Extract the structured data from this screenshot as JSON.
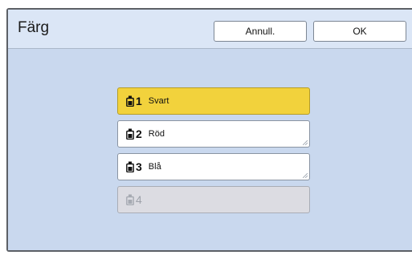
{
  "dialog": {
    "title": "Färg",
    "cancel_label": "Annull.",
    "ok_label": "OK"
  },
  "options": [
    {
      "number": "1",
      "name": "Svart",
      "state": "selected",
      "icon": "ink-bottle-icon"
    },
    {
      "number": "2",
      "name": "Röd",
      "state": "normal",
      "icon": "ink-bottle-icon"
    },
    {
      "number": "3",
      "name": "Blå",
      "state": "normal",
      "icon": "ink-bottle-icon"
    },
    {
      "number": "4",
      "name": "",
      "state": "disabled",
      "icon": "ink-bottle-icon"
    }
  ],
  "colors": {
    "panel": "#c9d8ee",
    "header": "#dbe6f6",
    "selected": "#f2d23c",
    "disabled": "#dcdce2"
  }
}
